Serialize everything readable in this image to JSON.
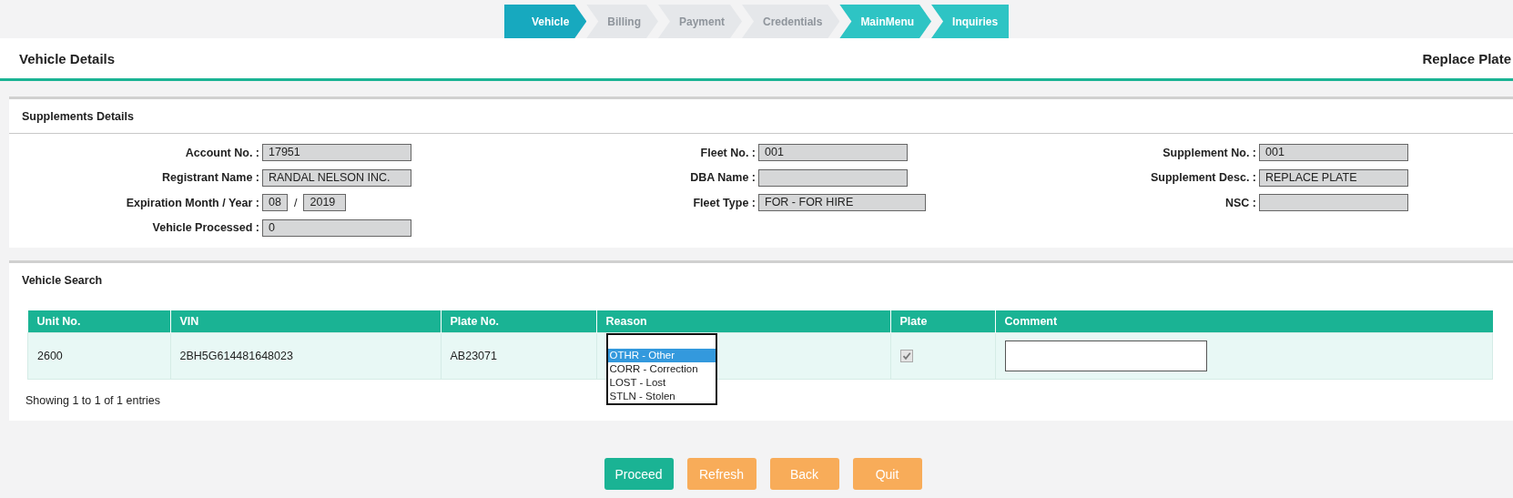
{
  "steps": [
    {
      "label": "Vehicle",
      "selected": true,
      "enabled": true
    },
    {
      "label": "Billing",
      "selected": false,
      "enabled": false
    },
    {
      "label": "Payment",
      "selected": false,
      "enabled": false
    },
    {
      "label": "Credentials",
      "selected": false,
      "enabled": false
    },
    {
      "label": "MainMenu",
      "selected": false,
      "enabled": true
    },
    {
      "label": "Inquiries",
      "selected": false,
      "enabled": true
    }
  ],
  "header": {
    "title": "Vehicle Details",
    "action": "Replace Plate"
  },
  "supplements": {
    "title": "Supplements Details",
    "columns": [
      [
        {
          "label": "Account No. :",
          "kind": "text",
          "values": [
            "17951"
          ]
        },
        {
          "label": "Registrant Name :",
          "kind": "text",
          "values": [
            "RANDAL NELSON INC."
          ]
        },
        {
          "label": "Expiration Month / Year :",
          "kind": "pair",
          "values": [
            "08",
            "2019"
          ],
          "separator": "/"
        },
        {
          "label": "Vehicle Processed :",
          "kind": "text",
          "values": [
            "0"
          ]
        }
      ],
      [
        {
          "label": "Fleet No. :",
          "kind": "text",
          "values": [
            "001"
          ]
        },
        {
          "label": "DBA Name :",
          "kind": "text"
        },
        {
          "label": "Fleet Type :",
          "kind": "wide",
          "values": [
            "FOR - FOR HIRE"
          ]
        }
      ],
      [
        {
          "label": "Supplement No. :",
          "kind": "text",
          "values": [
            "001"
          ]
        },
        {
          "label": "Supplement Desc. :",
          "kind": "text",
          "values": [
            "REPLACE PLATE"
          ]
        },
        {
          "label": "NSC :",
          "kind": "text"
        }
      ]
    ]
  },
  "vehicle_search": {
    "title": "Vehicle Search",
    "columns": [
      "Unit No.",
      "VIN",
      "Plate No.",
      "Reason",
      "Plate",
      "Comment"
    ],
    "rows": [
      {
        "unit_no": "2600",
        "vin": "2BH5G614481648023",
        "plate_no": "AB23071",
        "reason_options": [
          {
            "label": "OTHR - Other",
            "selected": true
          },
          {
            "label": "CORR - Correction",
            "selected": false
          },
          {
            "label": "LOST - Lost",
            "selected": false
          },
          {
            "label": "STLN - Stolen",
            "selected": false
          }
        ],
        "plate_checked": true,
        "plate_disabled": true,
        "comment": ""
      }
    ],
    "footer": "Showing 1 to 1 of 1 entries"
  },
  "buttons": [
    {
      "label": "Proceed",
      "kind": "primary"
    },
    {
      "label": "Refresh",
      "kind": "warning"
    },
    {
      "label": "Back",
      "kind": "warning"
    },
    {
      "label": "Quit",
      "kind": "warning"
    }
  ]
}
